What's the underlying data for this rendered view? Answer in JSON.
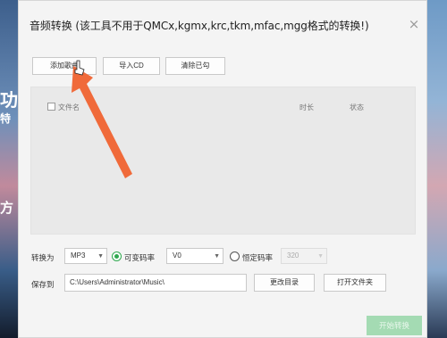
{
  "dialog": {
    "title": "音频转换 (该工具不用于QMCx,kgmx,krc,tkm,mfac,mgg格式的转换!)",
    "close_symbol": "×"
  },
  "toolbar": {
    "add_song": "添加歌曲",
    "import_cd": "导入CD",
    "clear_done": "清除已勾"
  },
  "list": {
    "columns": {
      "file_name": "文件名",
      "duration": "时长",
      "status": "状态"
    }
  },
  "convert": {
    "label": "转换为",
    "format": "MP3",
    "vbr_label": "可变码率",
    "vbr_value": "V0",
    "cbr_label": "恒定码率",
    "cbr_value": "320"
  },
  "save": {
    "label": "保存到",
    "path": "C:\\Users\\Administrator\\Music\\",
    "change_dir": "更改目录",
    "open_folder": "打开文件夹"
  },
  "start_button": "开始转换",
  "background": {
    "glyph_1": "功",
    "glyph_2": "特",
    "glyph_3": "方"
  },
  "colors": {
    "accent_green": "#2fa84f",
    "start_button_disabled": "#a4dbb3",
    "annotation_arrow": "#f06a3a"
  }
}
